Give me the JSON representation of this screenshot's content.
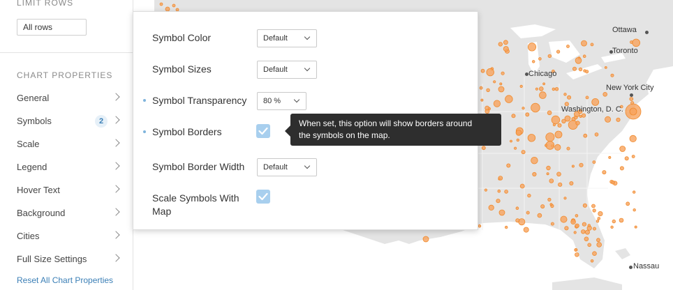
{
  "sidebar": {
    "limit_rows_title": "LIMIT ROWS",
    "limit_rows_value": "All rows",
    "chart_properties_title": "CHART PROPERTIES",
    "items": [
      {
        "label": "General"
      },
      {
        "label": "Symbols",
        "badge": "2"
      },
      {
        "label": "Scale"
      },
      {
        "label": "Legend"
      },
      {
        "label": "Hover Text"
      },
      {
        "label": "Background"
      },
      {
        "label": "Cities"
      },
      {
        "label": "Full Size Settings"
      }
    ],
    "reset_label": "Reset All Chart Properties"
  },
  "panel": {
    "symbol_color_label": "Symbol Color",
    "symbol_color_value": "Default",
    "symbol_sizes_label": "Symbol Sizes",
    "symbol_sizes_value": "Default",
    "symbol_transparency_label": "Symbol Transparency",
    "symbol_transparency_value": "80 %",
    "symbol_borders_label": "Symbol Borders",
    "symbol_borders_checked": true,
    "symbol_border_width_label": "Symbol Border Width",
    "symbol_border_width_value": "Default",
    "scale_symbols_label_line1": "Scale Symbols With",
    "scale_symbols_label_line2": "Map",
    "scale_symbols_checked": true
  },
  "tooltip": {
    "line1": "When set, this option will show borders around",
    "line2": "the symbols on the map."
  },
  "map": {
    "cities": {
      "ottawa": "Ottawa",
      "toronto": "Toronto",
      "chicago": "Chicago",
      "new_york": "New York City",
      "washington": "Washington, D. C.",
      "nassau": "Nassau"
    }
  },
  "colors": {
    "symbol": "#f7a35c",
    "symbol_stroke": "#f08a2c",
    "accent": "#3b7fb6",
    "checkbox": "#a8cfee",
    "tooltip_bg": "#2e2e2e"
  }
}
